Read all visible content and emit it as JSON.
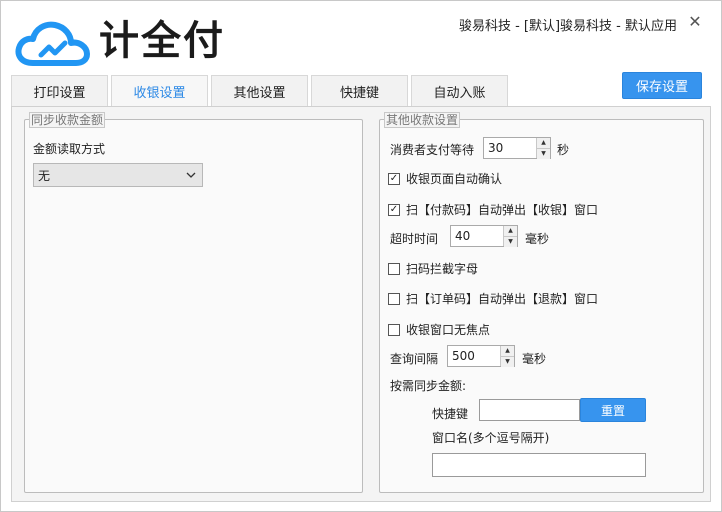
{
  "header": {
    "brand_name": "计全付",
    "title": "骏易科技 - [默认]骏易科技 - 默认应用",
    "close_glyph": "✕"
  },
  "tabs": [
    {
      "label": "打印设置",
      "active": false
    },
    {
      "label": "收银设置",
      "active": true
    },
    {
      "label": "其他设置",
      "active": false
    },
    {
      "label": "快捷键",
      "active": false
    },
    {
      "label": "自动入账",
      "active": false
    }
  ],
  "toolbar": {
    "save_label": "保存设置"
  },
  "sync_group": {
    "title": "同步收款金额",
    "read_mode_label": "金额读取方式",
    "read_mode_value": "无"
  },
  "other_group": {
    "title": "其他收款设置",
    "wait_label": "消费者支付等待",
    "wait_value": "30",
    "wait_unit": "秒",
    "auto_confirm_label": "收银页面自动确认",
    "auto_confirm_checked": true,
    "scan_pay_label": "扫【付款码】自动弹出【收银】窗口",
    "scan_pay_checked": true,
    "timeout_label": "超时时间",
    "timeout_value": "40",
    "timeout_unit": "毫秒",
    "intercept_label": "扫码拦截字母",
    "intercept_checked": false,
    "scan_order_label": "扫【订单码】自动弹出【退款】窗口",
    "scan_order_checked": false,
    "no_focus_label": "收银窗口无焦点",
    "no_focus_checked": false,
    "interval_label": "查询间隔",
    "interval_value": "500",
    "interval_unit": "毫秒",
    "sync_amount_label": "按需同步金额:",
    "hotkey_label": "快捷键",
    "hotkey_value": "",
    "reset_label": "重置",
    "window_name_label": "窗口名(多个逗号隔开)",
    "window_name_value": ""
  },
  "colors": {
    "accent": "#3794ee",
    "active_tab_text": "#2e8ae6",
    "logo_blue": "#2196f3"
  },
  "icons": {
    "logo": "cloud-logo-icon",
    "close": "close-icon",
    "select_arrow": "chevron-down-icon",
    "spin_up": "arrow-up-icon",
    "spin_down": "arrow-down-icon",
    "check": "checkmark-icon"
  }
}
